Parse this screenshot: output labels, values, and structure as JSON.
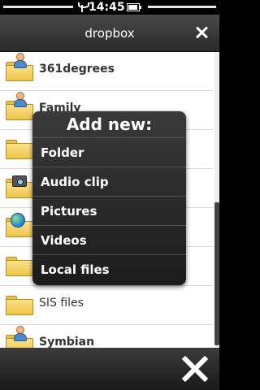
{
  "status": {
    "time": "14:45",
    "battery_level": 0.8
  },
  "title_bar": {
    "title": "dropbox"
  },
  "list": {
    "items": [
      {
        "label": "361degrees",
        "icon": "user-folder-icon"
      },
      {
        "label": "Family",
        "icon": "user-folder-icon"
      },
      {
        "label": "",
        "icon": "folder-icon"
      },
      {
        "label": "",
        "icon": "camera-folder-icon"
      },
      {
        "label": "",
        "icon": "globe-folder-icon"
      },
      {
        "label": "",
        "icon": "folder-icon"
      },
      {
        "label": "SIS files",
        "icon": "folder-icon"
      },
      {
        "label": "Symbian",
        "icon": "user-folder-icon"
      }
    ]
  },
  "popup": {
    "title": "Add new:",
    "items": [
      "Folder",
      "Audio clip",
      "Pictures",
      "Videos",
      "Local files"
    ]
  }
}
